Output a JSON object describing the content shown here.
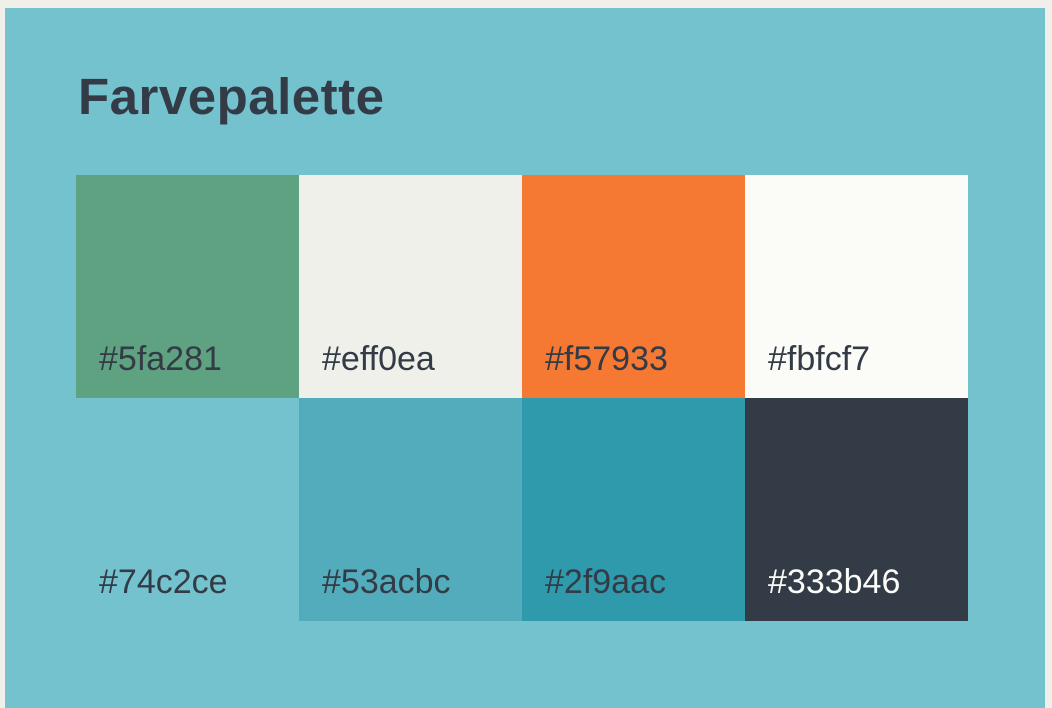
{
  "title": "Farvepalette",
  "swatches": [
    {
      "label": "#5fa281",
      "color": "#5fa281",
      "text_color": "#333b46"
    },
    {
      "label": "#eff0ea",
      "color": "#eff0ea",
      "text_color": "#333b46"
    },
    {
      "label": "#f57933",
      "color": "#f57933",
      "text_color": "#333b46"
    },
    {
      "label": "#fbfcf7",
      "color": "#fbfcf7",
      "text_color": "#333b46"
    },
    {
      "label": "#74c2ce",
      "color": "#74c2ce",
      "text_color": "#333b46"
    },
    {
      "label": "#53acbc",
      "color": "#53acbc",
      "text_color": "#333b46"
    },
    {
      "label": "#2f9aac",
      "color": "#2f9aac",
      "text_color": "#333b46"
    },
    {
      "label": "#333b46",
      "color": "#333b46",
      "text_color": "#fbfcf7"
    }
  ]
}
